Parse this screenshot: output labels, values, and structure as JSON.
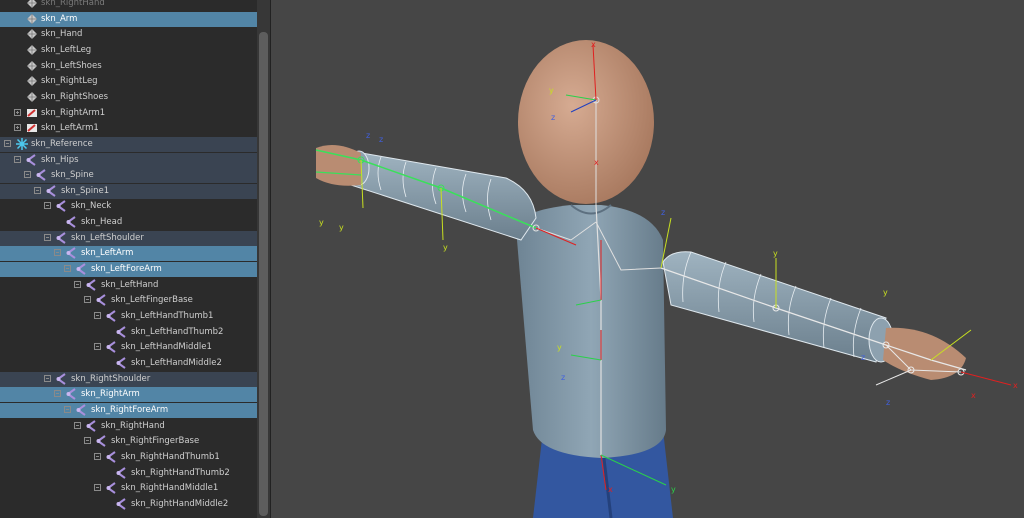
{
  "outliner": {
    "items": [
      {
        "label": "skn_RightHand",
        "icon": "mesh-icon",
        "indent": 1,
        "state": "faded"
      },
      {
        "label": "skn_Arm",
        "icon": "mesh-icon",
        "indent": 1,
        "state": "selected"
      },
      {
        "label": "skn_Hand",
        "icon": "mesh-icon",
        "indent": 1,
        "state": "normal"
      },
      {
        "label": "skn_LeftLeg",
        "icon": "mesh-icon",
        "indent": 1,
        "state": "normal"
      },
      {
        "label": "skn_LeftShoes",
        "icon": "mesh-icon",
        "indent": 1,
        "state": "normal"
      },
      {
        "label": "skn_RightLeg",
        "icon": "mesh-icon",
        "indent": 1,
        "state": "normal"
      },
      {
        "label": "skn_RightShoes",
        "icon": "mesh-icon",
        "indent": 1,
        "state": "normal"
      },
      {
        "label": "skn_RightArm1",
        "icon": "brush-icon",
        "indent": 1,
        "state": "normal",
        "expander": "plus"
      },
      {
        "label": "skn_LeftArm1",
        "icon": "brush-icon",
        "indent": 1,
        "state": "normal",
        "expander": "plus"
      },
      {
        "label": "skn_Reference",
        "icon": "asterisk-icon",
        "indent": 0,
        "state": "group",
        "expander": "minus"
      },
      {
        "label": "skn_Hips",
        "icon": "joint-icon",
        "indent": 1,
        "state": "group",
        "expander": "minus"
      },
      {
        "label": "skn_Spine",
        "icon": "joint-icon",
        "indent": 2,
        "state": "group",
        "expander": "minus"
      },
      {
        "label": "skn_Spine1",
        "icon": "joint-icon",
        "indent": 3,
        "state": "group",
        "expander": "minus"
      },
      {
        "label": "skn_Neck",
        "icon": "joint-icon",
        "indent": 4,
        "state": "normal",
        "expander": "minus"
      },
      {
        "label": "skn_Head",
        "icon": "joint-icon",
        "indent": 5,
        "state": "normal"
      },
      {
        "label": "skn_LeftShoulder",
        "icon": "joint-icon",
        "indent": 4,
        "state": "group",
        "expander": "minus"
      },
      {
        "label": "skn_LeftArm",
        "icon": "joint-icon",
        "indent": 5,
        "state": "selected",
        "expander": "minus"
      },
      {
        "label": "skn_LeftForeArm",
        "icon": "joint-icon",
        "indent": 6,
        "state": "selected",
        "expander": "minus"
      },
      {
        "label": "skn_LeftHand",
        "icon": "joint-icon",
        "indent": 7,
        "state": "normal",
        "expander": "minus"
      },
      {
        "label": "skn_LeftFingerBase",
        "icon": "joint-icon",
        "indent": 8,
        "state": "normal",
        "expander": "minus"
      },
      {
        "label": "skn_LeftHandThumb1",
        "icon": "joint-icon",
        "indent": 9,
        "state": "normal",
        "expander": "minus"
      },
      {
        "label": "skn_LeftHandThumb2",
        "icon": "joint-icon",
        "indent": 10,
        "state": "normal"
      },
      {
        "label": "skn_LeftHandMiddle1",
        "icon": "joint-icon",
        "indent": 9,
        "state": "normal",
        "expander": "minus"
      },
      {
        "label": "skn_LeftHandMiddle2",
        "icon": "joint-icon",
        "indent": 10,
        "state": "normal"
      },
      {
        "label": "skn_RightShoulder",
        "icon": "joint-icon",
        "indent": 4,
        "state": "group",
        "expander": "minus"
      },
      {
        "label": "skn_RightArm",
        "icon": "joint-icon",
        "indent": 5,
        "state": "selected",
        "expander": "minus"
      },
      {
        "label": "skn_RightForeArm",
        "icon": "joint-icon",
        "indent": 6,
        "state": "selected",
        "expander": "minus"
      },
      {
        "label": "skn_RightHand",
        "icon": "joint-icon",
        "indent": 7,
        "state": "normal",
        "expander": "minus"
      },
      {
        "label": "skn_RightFingerBase",
        "icon": "joint-icon",
        "indent": 8,
        "state": "normal",
        "expander": "minus"
      },
      {
        "label": "skn_RightHandThumb1",
        "icon": "joint-icon",
        "indent": 9,
        "state": "normal",
        "expander": "minus"
      },
      {
        "label": "skn_RightHandThumb2",
        "icon": "joint-icon",
        "indent": 10,
        "state": "normal"
      },
      {
        "label": "skn_RightHandMiddle1",
        "icon": "joint-icon",
        "indent": 9,
        "state": "normal",
        "expander": "minus"
      },
      {
        "label": "skn_RightHandMiddle2",
        "icon": "joint-icon",
        "indent": 10,
        "state": "normal"
      }
    ]
  },
  "viewport": {
    "axis_labels": {
      "x": "x",
      "y": "y",
      "z": "z"
    },
    "colors": {
      "background": "#464646",
      "head": "#c99a80",
      "body": "#7f95a4",
      "pants": "#3357a0",
      "bone_highlight": "#3ae05a",
      "axis_x": "#e02020",
      "axis_y": "#c8e020",
      "axis_z": "#2040c0"
    }
  }
}
